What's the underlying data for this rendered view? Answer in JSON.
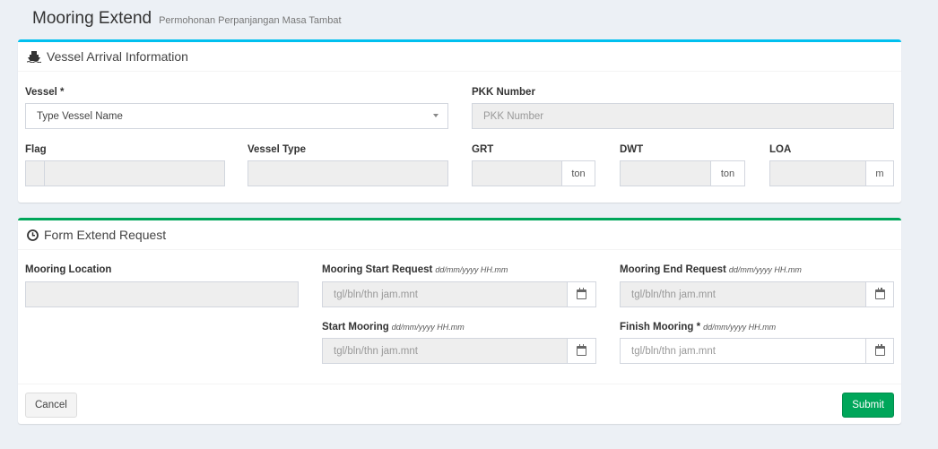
{
  "header": {
    "title": "Mooring Extend",
    "subtitle": "Permohonan Perpanjangan Masa Tambat"
  },
  "vessel_section": {
    "title": "Vessel Arrival Information",
    "vessel_label": "Vessel *",
    "vessel_value": "Type Vessel Name",
    "pkk_label": "PKK Number",
    "pkk_placeholder": "PKK Number",
    "flag_label": "Flag",
    "vessel_type_label": "Vessel Type",
    "grt_label": "GRT",
    "grt_unit": "ton",
    "dwt_label": "DWT",
    "dwt_unit": "ton",
    "loa_label": "LOA",
    "loa_unit": "m"
  },
  "form_section": {
    "title": "Form Extend Request",
    "mooring_location_label": "Mooring Location",
    "start_request_label": "Mooring Start Request",
    "end_request_label": "Mooring End Request",
    "start_mooring_label": "Start Mooring",
    "finish_mooring_label": "Finish Mooring *",
    "date_hint": "dd/mm/yyyy HH.mm",
    "date_placeholder": "tgl/bln/thn jam.mnt"
  },
  "footer": {
    "cancel_label": "Cancel",
    "submit_label": "Submit"
  },
  "colors": {
    "info_accent": "#00c0ef",
    "success_accent": "#00a65a"
  }
}
